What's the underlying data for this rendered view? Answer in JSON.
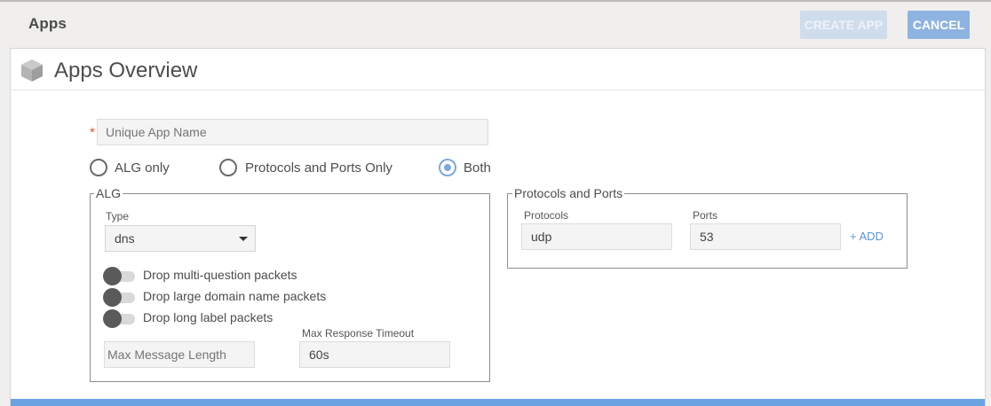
{
  "header": {
    "title": "Apps",
    "create_label": "CREATE APP",
    "cancel_label": "CANCEL"
  },
  "panel": {
    "title": "Apps Overview",
    "icon": "cube-icon"
  },
  "form": {
    "required_mark": "*",
    "app_name_placeholder": "Unique App Name",
    "app_name_value": "",
    "mode_options": [
      {
        "label": "ALG only",
        "checked": false
      },
      {
        "label": "Protocols and Ports Only",
        "checked": false
      },
      {
        "label": "Both",
        "checked": true
      }
    ],
    "alg": {
      "legend": "ALG",
      "type_label": "Type",
      "type_value": "dns",
      "toggles": [
        {
          "label": "Drop multi-question packets",
          "on": false
        },
        {
          "label": "Drop large domain name packets",
          "on": false
        },
        {
          "label": "Drop long label packets",
          "on": false
        }
      ],
      "max_message_placeholder": "Max Message Length",
      "max_message_value": "",
      "max_response_label": "Max Response Timeout",
      "max_response_value": "60s"
    },
    "protocols_ports": {
      "legend": "Protocols and Ports",
      "protocols_label": "Protocols",
      "protocols_value": "udp",
      "ports_label": "Ports",
      "ports_value": "53",
      "add_label": "+ ADD"
    }
  },
  "colors": {
    "accent": "#6aa2e2",
    "cancel_button": "#8fb3e0",
    "create_button_disabled": "#cfdcec",
    "required": "#e0502a"
  }
}
